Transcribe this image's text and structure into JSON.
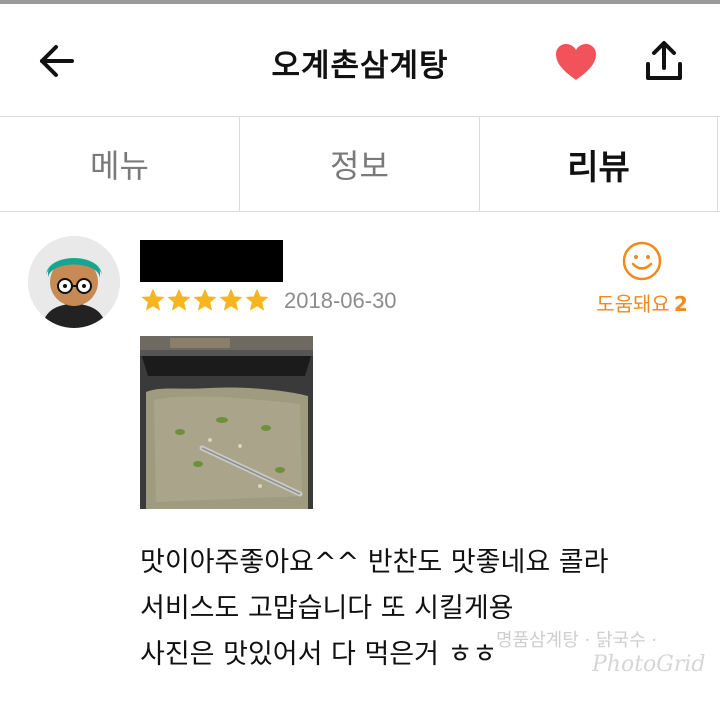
{
  "header": {
    "title": "오계촌삼계탕",
    "back_icon": "arrow-left-icon",
    "favorite_icon": "heart-icon",
    "favorite_color": "#f2535b",
    "share_icon": "share-icon"
  },
  "tabs": [
    {
      "label": "메뉴",
      "active": false
    },
    {
      "label": "정보",
      "active": false
    },
    {
      "label": "리뷰",
      "active": true
    }
  ],
  "review": {
    "rating": 5,
    "rating_max": 5,
    "star_color": "#f5b51e",
    "date": "2018-06-30",
    "helpful_label": "도움돼요",
    "helpful_count": "2",
    "helpful_color": "#f08a1c",
    "lines": [
      "맛이아주좋아요^^ 반찬도 맛좋네요 콜라",
      "서비스도 고맙습니다 또 시킬게용",
      "사진은 맛있어서 다 먹은거 ㅎㅎ"
    ]
  },
  "watermark": {
    "text": "명품삼계탕 · 닭국수 ·",
    "logo": "PhotoGrid"
  }
}
